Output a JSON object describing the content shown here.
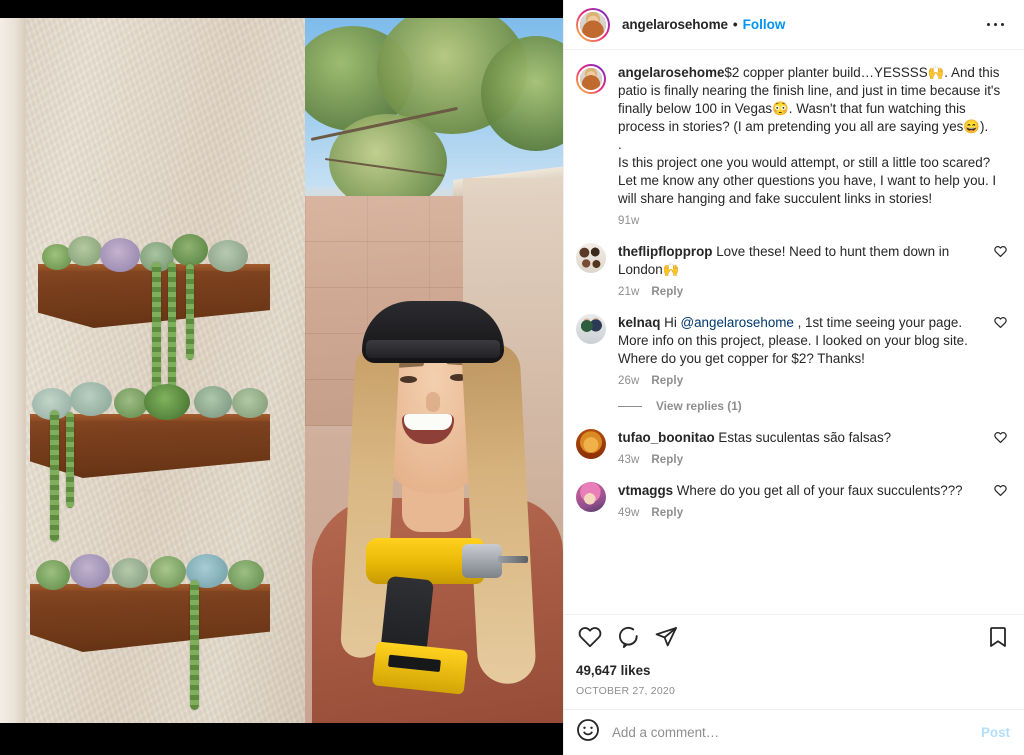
{
  "header": {
    "avatar_icon": "profile-avatar",
    "username": "angelarosehome",
    "separator": "•",
    "follow_label": "Follow",
    "more_icon": "more-options-icon"
  },
  "caption": {
    "username": "angelarosehome",
    "avatar_icon": "profile-avatar",
    "paragraphs": [
      "$2 copper planter build…YESSSS🙌. And this patio is finally nearing the finish line, and just in time because it's finally below 100 in Vegas😳. Wasn't that fun watching this process in stories? (I am pretending you all are saying yes😄).",
      ".",
      "Is this project one you would attempt, or still a little too scared? Let me know any other questions you have, I want to help you. I will share hanging and fake succulent links in stories!"
    ],
    "timestamp": "91w"
  },
  "comments": [
    {
      "avatar_icon": "commenter-avatar-family",
      "username": "theflipflopprop",
      "text": " Love these! Need to hunt them down in London🙌",
      "timestamp": "21w",
      "reply_label": "Reply",
      "like_icon": "heart-icon",
      "mention": "",
      "has_replies": false
    },
    {
      "avatar_icon": "commenter-avatar-couple",
      "username": "kelnaq",
      "text_before": " Hi ",
      "mention": "@angelarosehome",
      "text_after": " , 1st time seeing your page. More info on this project, please. I looked on your blog site. Where do you get copper for $2? Thanks!",
      "timestamp": "26w",
      "reply_label": "Reply",
      "like_icon": "heart-icon",
      "has_replies": true,
      "view_replies_label": "View replies (1)"
    },
    {
      "avatar_icon": "commenter-avatar-dog",
      "username": "tufao_boonitao",
      "text": " Estas suculentas são falsas?",
      "timestamp": "43w",
      "reply_label": "Reply",
      "like_icon": "heart-icon",
      "mention": "",
      "has_replies": false
    },
    {
      "avatar_icon": "commenter-avatar-pink",
      "username": "vtmaggs",
      "text": " Where do you get all of your faux succulents???",
      "timestamp": "49w",
      "reply_label": "Reply",
      "like_icon": "heart-icon",
      "mention": "",
      "has_replies": false
    }
  ],
  "actions": {
    "like_icon": "heart-icon",
    "comment_icon": "comment-bubble-icon",
    "share_icon": "share-paper-plane-icon",
    "save_icon": "bookmark-icon",
    "likes_count": "49,647 likes",
    "date": "OCTOBER 27, 2020"
  },
  "add_comment": {
    "emoji_icon": "emoji-smiley-icon",
    "placeholder": "Add a comment…",
    "value": "",
    "post_label": "Post"
  },
  "media": {
    "alt": "Woman in backwards cap holding yellow DeWalt drill beside stucco wall with three wooden planter boxes of succulents",
    "background": "#000000"
  },
  "colors": {
    "accent_blue": "#0095f6",
    "post_blue_disabled": "#b3dffc",
    "mention_blue": "#00376b",
    "text_primary": "#262626",
    "text_secondary": "#8e8e8e",
    "divider": "#efefef"
  }
}
